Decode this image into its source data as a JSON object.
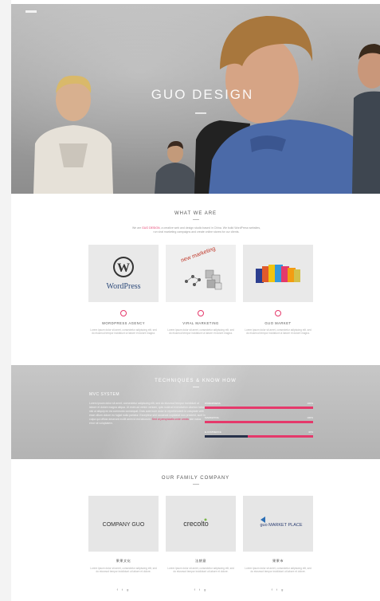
{
  "hero": {
    "title": "GUO DESIGN"
  },
  "what_we_are": {
    "title": "WHAT WE ARE",
    "intro_before": "We are",
    "intro_highlight": "GUO DESIGN",
    "intro_after": ", a creative web and design studio based in China. We build WordPress websites, run viral marketing campaigns and create online stores for our clients.",
    "cards": [
      {
        "image_label": "WordPress",
        "title": "WORDPRESS AGENCY",
        "text": "Lorem ipsum dolor sit amet, consectetur adipiscing elit, sed do eiusmod tempor incididunt ut labore et dolore magna."
      },
      {
        "image_label": "new marketing",
        "title": "VIRAL MARKETING",
        "text": "Lorem ipsum dolor sit amet, consectetur adipiscing elit, sed do eiusmod tempor incididunt ut labore et dolore magna."
      },
      {
        "image_label": "",
        "title": "GUO MARKET",
        "text": "Lorem ipsum dolor sit amet, consectetur adipiscing elit, sed do eiusmod tempor incididunt ut labore et dolore magna."
      }
    ]
  },
  "techniques": {
    "title": "TECHNIQUES & KNOW HOW",
    "subtitle": "MVC SYSTEM",
    "text_before": "Lorem ipsum dolor sit amet, consectetur adipiscing elit, sed do eiusmod tempor incididunt ut labore et dolore magna aliqua. Ut enim ad minim veniam, quis nostrud exercitation ullamco laboris nisi ut aliquip ex ea commodo consequat. Duis aute irure dolor in reprehenderit in voluptate velit esse cillum dolore eu fugiat nulla pariatur. Excepteur sint occaecat cupidatat non proident, sunt in culpa qui officia deserunt mollit anim id est laborum.",
    "text_highlight": "Sed ut perspiciatis unde omnis",
    "text_after": " iste natus error sit voluptatem.",
    "bars": [
      {
        "label": "WORDPRESS",
        "value_text": "100%",
        "value": 1.0,
        "style": "pink"
      },
      {
        "label": "MARKETING",
        "value_text": "100%",
        "value": 1.0,
        "style": "pink"
      },
      {
        "label": "E-COMMERCE",
        "value_text": "40%",
        "value": 0.4,
        "style": "mixed"
      }
    ]
  },
  "family": {
    "title": "OUR FAMILY COMPANY",
    "companies": [
      {
        "logo": "COMPANY GUO",
        "name": "果果文化",
        "text": "Lorem ipsum dolor sit amet, consectetur adipiscing elit, sed do eiusmod tempor incididunt ut labore et dolore.",
        "social": "f t g"
      },
      {
        "logo": "crecolto",
        "name": "法朗意",
        "text": "Lorem ipsum dolor sit amet, consectetur adipiscing elit, sed do eiusmod tempor incididunt ut labore et dolore.",
        "social": "f t g"
      },
      {
        "logo": "guo MARKET PLACE",
        "name": "果果市",
        "text": "Lorem ipsum dolor sit amet, consectetur adipiscing elit, sed do eiusmod tempor incididunt ut labore et dolore.",
        "social": "f t g"
      }
    ]
  },
  "colors": {
    "accent": "#e5396b",
    "dark_bar": "#27314a"
  }
}
